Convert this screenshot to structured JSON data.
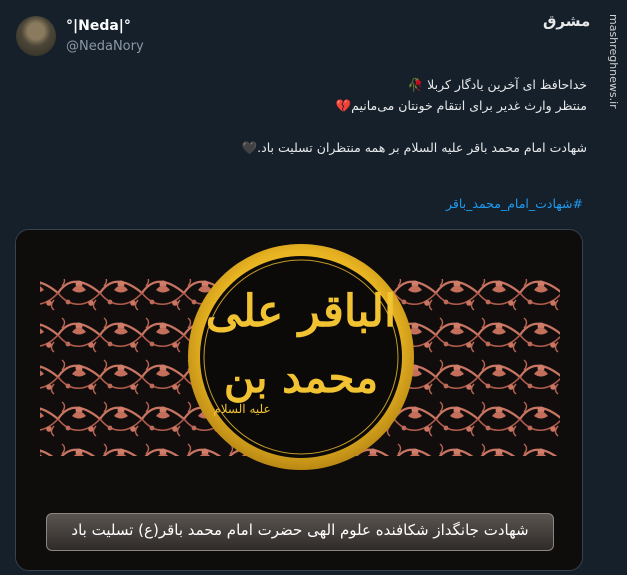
{
  "author": {
    "display_name": "°|Neda|°",
    "handle": "@NedaNory"
  },
  "tweet": {
    "lines": [
      "خداحافظ ای آخرین یادگار کربلا 🥀",
      "منتظر وارث غدیر برای انتقام خونتان می‌مانیم💔",
      "",
      "شهادت امام محمد باقر علیه السلام بر همه منتظران تسلیت باد.🖤"
    ],
    "hashtag": "#شهادت_امام_محمد_باقر"
  },
  "media": {
    "calligraphy_top": "الباقر علی",
    "calligraphy_bottom": "محمد بن",
    "calligraphy_small": "علیه السلام",
    "caption": "شهادت جانگداز شکافنده علوم الهی حضرت امام محمد باقر(ع) تسلیت باد",
    "colors": {
      "pattern": "#d27a67",
      "ring_gold": "#e8b422",
      "calligraphy": "#f1c232",
      "background": "#0f0c0c"
    }
  },
  "watermark": {
    "logo": "مشرق",
    "site": "mashreghnews.ir"
  }
}
